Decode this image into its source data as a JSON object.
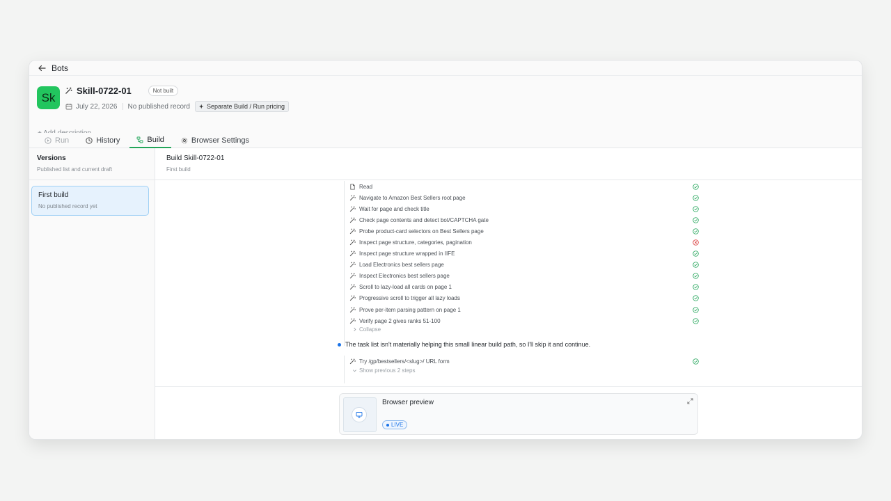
{
  "nav": {
    "back_label": "Bots"
  },
  "bot": {
    "avatar_initials": "Sk",
    "name": "Skill-0722-01",
    "status_badge": "Not built",
    "date": "July 22, 2026",
    "published_status": "No published record",
    "pricing_label": "Separate Build / Run pricing",
    "add_description": "+ Add description..."
  },
  "tabs": [
    {
      "label": "Run",
      "icon": "play-icon",
      "state": "disabled"
    },
    {
      "label": "History",
      "icon": "clock-icon",
      "state": "normal"
    },
    {
      "label": "Build",
      "icon": "build-icon",
      "state": "active"
    },
    {
      "label": "Browser Settings",
      "icon": "gear-icon",
      "state": "normal"
    }
  ],
  "sidebar": {
    "title": "Versions",
    "subtitle": "Published list and current draft",
    "versions": [
      {
        "label": "First build",
        "sublabel": "No published record yet",
        "selected": true
      }
    ]
  },
  "main": {
    "title": "Build Skill-0722-01",
    "subtitle": "First build"
  },
  "steps": [
    {
      "label": "Read",
      "icon": "file-icon",
      "status": "success"
    },
    {
      "label": "Navigate to Amazon Best Sellers root page",
      "icon": "wand-icon",
      "status": "success"
    },
    {
      "label": "Wait for page and check title",
      "icon": "wand-icon",
      "status": "success"
    },
    {
      "label": "Check page contents and detect bot/CAPTCHA gate",
      "icon": "wand-icon",
      "status": "success"
    },
    {
      "label": "Probe product-card selectors on Best Sellers page",
      "icon": "wand-icon",
      "status": "success"
    },
    {
      "label": "Inspect page structure, categories, pagination",
      "icon": "wand-icon",
      "status": "error"
    },
    {
      "label": "Inspect page structure wrapped in IIFE",
      "icon": "wand-icon",
      "status": "success"
    },
    {
      "label": "Load Electronics best sellers page",
      "icon": "wand-icon",
      "status": "success"
    },
    {
      "label": "Inspect Electronics best sellers page",
      "icon": "wand-icon",
      "status": "success"
    },
    {
      "label": "Scroll to lazy-load all cards on page 1",
      "icon": "wand-icon",
      "status": "success"
    },
    {
      "label": "Progressive scroll to trigger all lazy loads",
      "icon": "wand-icon",
      "status": "success"
    },
    {
      "label": "Prove per-item parsing pattern on page 1",
      "icon": "wand-icon",
      "status": "success"
    },
    {
      "label": "Verify page 2 gives ranks 51-100",
      "icon": "wand-icon",
      "status": "success"
    }
  ],
  "collapse_label": "Collapse",
  "message": "The task list isn't materially helping this small linear build path, so I'll skip it and continue.",
  "steps2": [
    {
      "label": "Try /gp/bestsellers/<slug>/ URL form",
      "icon": "wand-icon",
      "status": "success"
    }
  ],
  "show_previous_label": "Show previous 2 steps",
  "preview": {
    "title": "Browser preview",
    "live_label": "LIVE"
  },
  "colors": {
    "accent_green": "#22a559",
    "success": "#22a559",
    "error": "#d93636",
    "live_blue": "#1a73e8"
  }
}
